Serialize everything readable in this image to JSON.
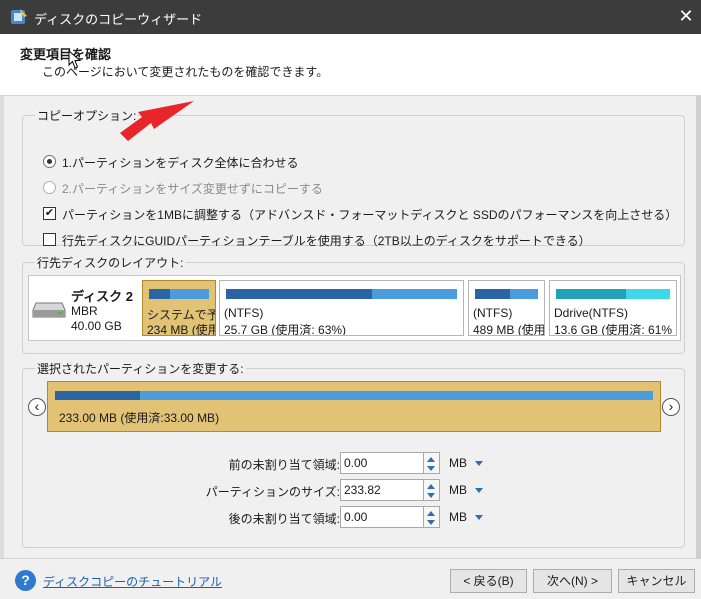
{
  "window": {
    "title": "ディスクのコピーウィザード",
    "close_glyph": "✕"
  },
  "header": {
    "title": "変更項目を確認",
    "subtitle": "このページにおいて変更されたものを確認できます。"
  },
  "copy_options": {
    "legend": "コピーオプション:",
    "options": [
      {
        "label": "1.パーティションをディスク全体に合わせる",
        "type": "radio",
        "selected": true,
        "enabled": true
      },
      {
        "label": "2.パーティションをサイズ変更せずにコピーする",
        "type": "radio",
        "selected": false,
        "enabled": false
      },
      {
        "label": "パーティションを1MBに調整する（アドバンスド・フォーマットディスクと SSDのパフォーマンスを向上させる）",
        "type": "checkbox",
        "checked": true,
        "check_glyph": "✔"
      },
      {
        "label": "行先ディスクにGUIDパーティションテーブルを使用する（2TB以上のディスクをサポートできる）",
        "type": "checkbox",
        "checked": false,
        "check_glyph": ""
      }
    ]
  },
  "dest_layout": {
    "legend": "行先ディスクのレイアウト:",
    "disk": {
      "name": "ディスク 2",
      "type": "MBR",
      "size": "40.00 GB"
    },
    "partitions": [
      {
        "line1": "システムで予約",
        "line2": "234 MB (使用",
        "used_fraction": 0.35,
        "selected": true,
        "color": "blue"
      },
      {
        "line1": "(NTFS)",
        "line2": "25.7 GB (使用済: 63%)",
        "used_fraction": 0.63,
        "selected": false,
        "color": "blue"
      },
      {
        "line1": "(NTFS)",
        "line2": "489 MB (使用",
        "used_fraction": 0.55,
        "selected": false,
        "color": "blue"
      },
      {
        "line1": "Ddrive(NTFS)",
        "line2": "13.6 GB (使用済: 61%",
        "used_fraction": 0.61,
        "selected": false,
        "color": "teal"
      }
    ]
  },
  "resize": {
    "legend": "選択されたパーティションを変更する:",
    "partition_label": "233.00 MB (使用済:33.00 MB)",
    "used_fraction": 0.142,
    "prev_glyph": "‹",
    "next_glyph": "›",
    "fields": [
      {
        "label": "前の未割り当て領域:",
        "value": "0.00",
        "unit": "MB"
      },
      {
        "label": "パーティションのサイズ:",
        "value": "233.82",
        "unit": "MB"
      },
      {
        "label": "後の未割り当て領域:",
        "value": "0.00",
        "unit": "MB"
      }
    ]
  },
  "footer": {
    "help_glyph": "?",
    "help_link": "ディスクコピーのチュートリアル",
    "back_button": "< 戻る(B)",
    "next_button": "次へ(N) >",
    "cancel_button": "キャンセル"
  },
  "colors": {
    "partition_selected": "#e2c274",
    "used_bar": "#2b64a3",
    "free_bar": "#4a9cdc",
    "teal_used": "#20a3b6",
    "teal_free": "#3fd7ea",
    "annotation_arrow": "#e8262a"
  }
}
